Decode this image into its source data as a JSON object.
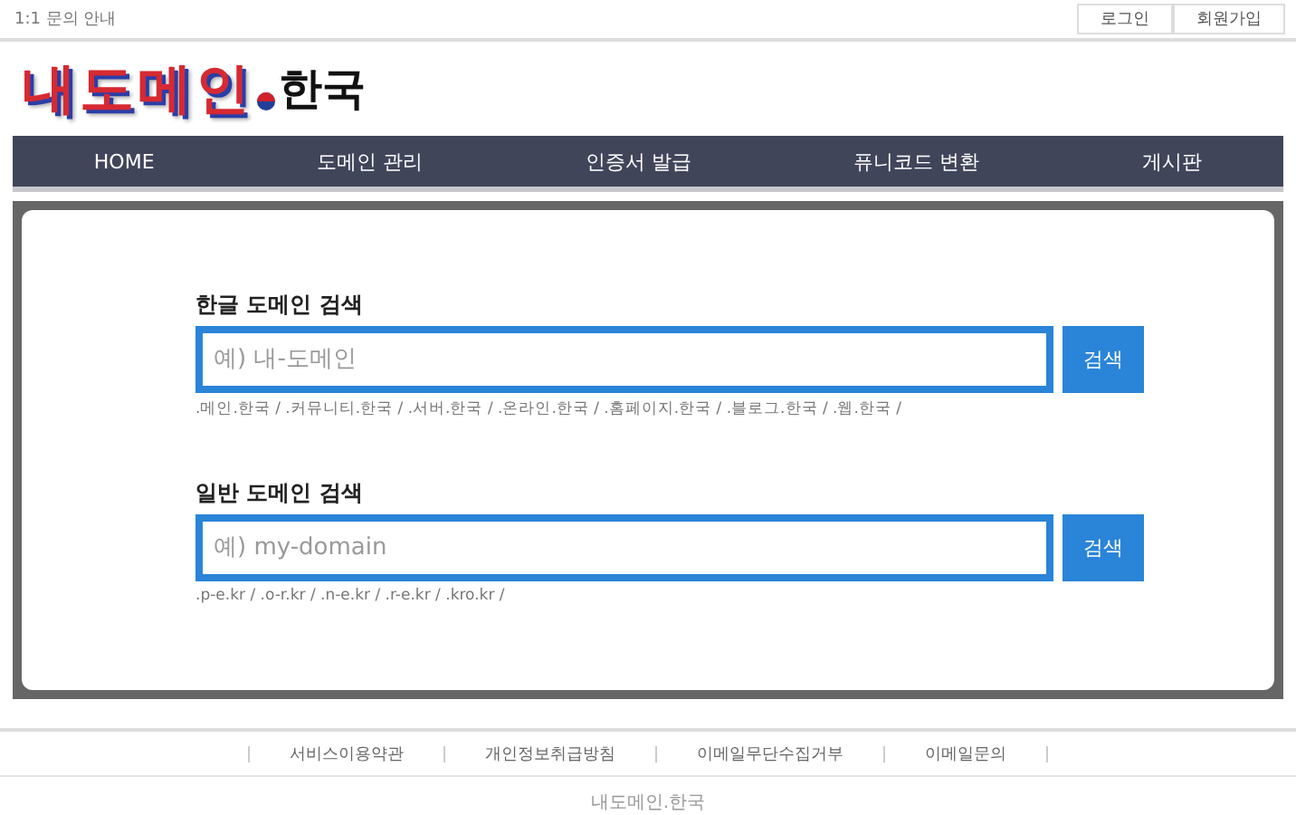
{
  "top_bar": {
    "notice": "1:1 문의 안내",
    "buttons": [
      "로그인",
      "회원가입"
    ]
  },
  "logo": {
    "text": "내도메인",
    "suffix": "한국"
  },
  "nav": [
    "HOME",
    "도메인 관리",
    "인증서 발급",
    "퓨니코드 변환",
    "게시판"
  ],
  "searches": [
    {
      "title": "한글 도메인 검색",
      "placeholder": "예) 내-도메인",
      "button": "검색",
      "suffixes": ".메인.한국 / .커뮤니티.한국 / .서버.한국 / .온라인.한국 / .홈페이지.한국 / .블로그.한국 / .웹.한국 /"
    },
    {
      "title": "일반 도메인 검색",
      "placeholder": "예) my-domain",
      "button": "검색",
      "suffixes": ".p-e.kr / .o-r.kr / .n-e.kr / .r-e.kr / .kro.kr /"
    }
  ],
  "footer": {
    "links": [
      "서비스이용약관",
      "개인정보취급방침",
      "이메일무단수집거부",
      "이메일문의"
    ],
    "site": "내도메인.한국"
  }
}
